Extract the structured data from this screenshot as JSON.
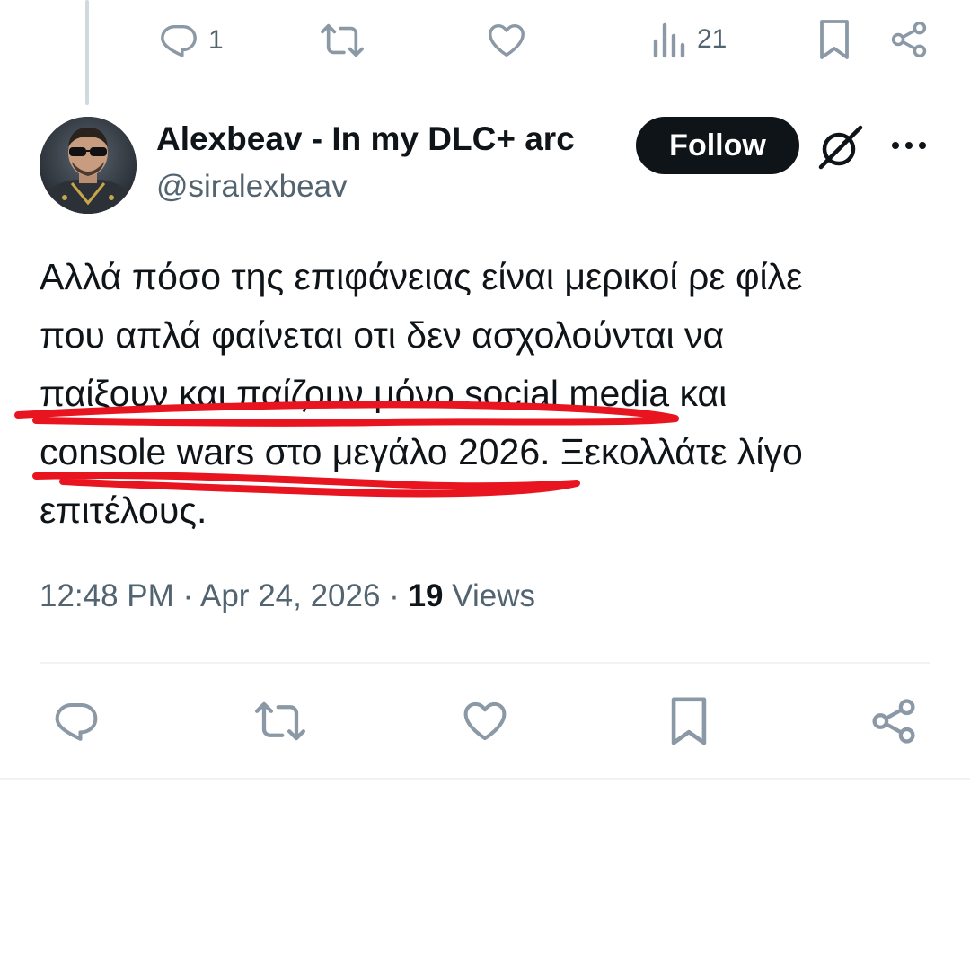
{
  "top_actions": {
    "reply_count": "1",
    "retweet_count": "",
    "like_count": "",
    "views_count": "21"
  },
  "tweet": {
    "display_name": "Alexbeav - In my DLC+ arc",
    "handle": "@siralexbeav",
    "follow_label": "Follow",
    "text_lines": [
      "Αλλά πόσο της επιφάνειας είναι μερικοί ρε φίλε",
      "που απλά φαίνεται οτι δεν ασχολούνται να",
      "παίξουν και παίζουν μόνο social media και",
      "console wars στο μεγάλο 2026. Ξεκολλάτε λίγο",
      "επιτέλους."
    ],
    "time": "12:48 PM",
    "separator": "·",
    "date": "Apr 24, 2026",
    "views_number": "19",
    "views_label": "Views"
  },
  "icons": {
    "reply": "reply-icon",
    "retweet": "retweet-icon",
    "like": "heart-icon",
    "views": "analytics-icon",
    "bookmark": "bookmark-icon",
    "share": "share-icon",
    "grok": "grok-icon",
    "more": "more-icon"
  },
  "colors": {
    "text": "#0f1419",
    "secondary": "#536471",
    "follow_bg": "#0f1419",
    "scribble": "#e8141f",
    "divider": "#eff3f4"
  }
}
